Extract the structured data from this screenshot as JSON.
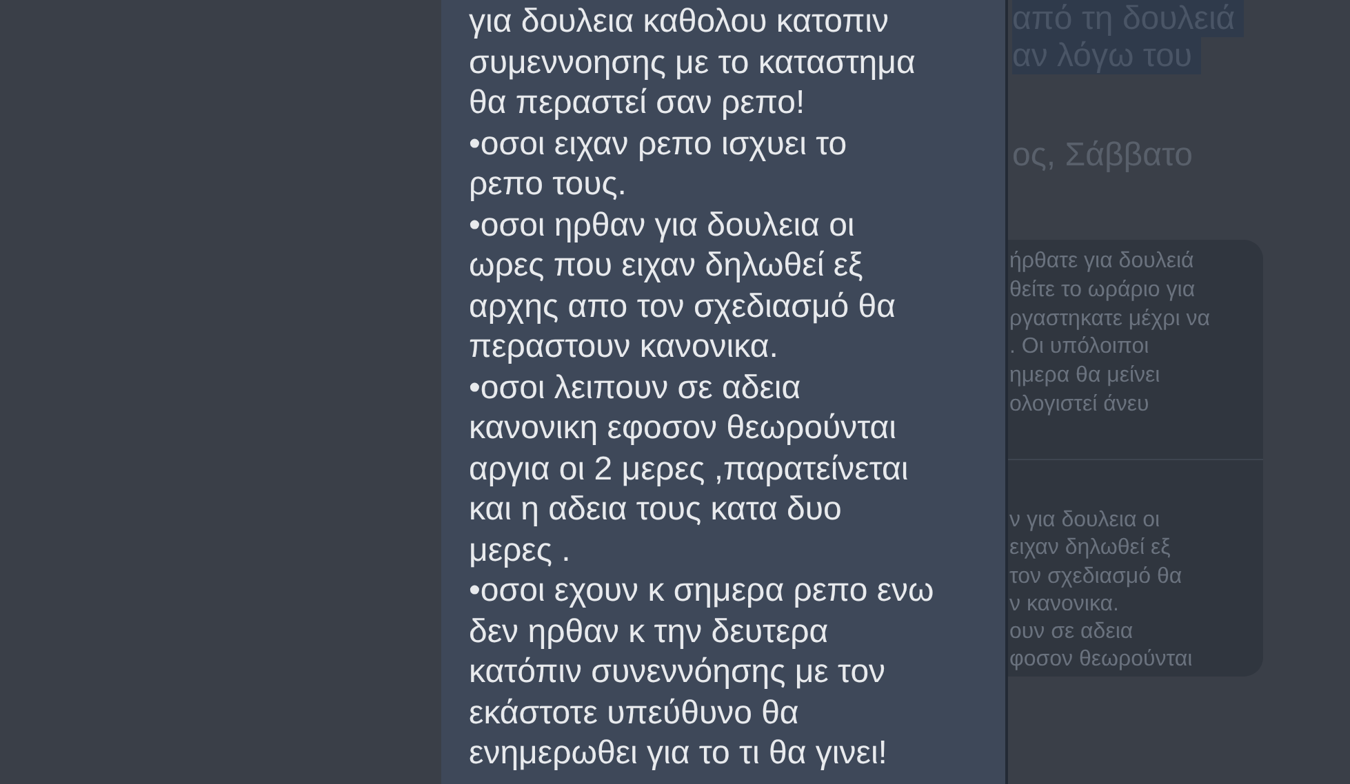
{
  "background": {
    "highlighted_lines": [
      "από τη δουλειά",
      "αν λόγω του"
    ],
    "date_line": "ος, Σάββατο",
    "card": {
      "upper_lines": [
        "ήρθατε για δουλειά",
        "θείτε το ωράριο για",
        "ργαστηκατε μέχρι να",
        ". Οι υπόλοιποι",
        "ημερα θα μείνει",
        "ολογιστεί άνευ"
      ],
      "lower_lines": [
        "ν για δουλεια οι",
        "ειχαν δηλωθεί εξ",
        "τον σχεδιασμό θα",
        "ν κανονικα.",
        "ουν σε αδεια",
        "φοσον θεωρούνται"
      ]
    }
  },
  "popup": {
    "paragraphs": [
      {
        "lines": [
          "για δουλεια καθολου κατοπιν",
          "συμεννοησης με το καταστημα",
          "θα περαστεί σαν ρεπο!"
        ]
      },
      {
        "lines": [
          "•οσοι ειχαν ρεπο ισχυει το",
          "ρεπο τους."
        ]
      },
      {
        "lines": [
          "•οσοι ηρθαν για δουλεια οι",
          "ωρες που ειχαν δηλωθεί εξ",
          "αρχης απο τον σχεδιασμό θα",
          "περαστουν κανονικα."
        ]
      },
      {
        "lines": [
          "•οσοι λειπουν σε αδεια",
          "κανονικη εφοσον θεωρούνται",
          "αργια οι 2 μερες ,παρατείνεται",
          "και η αδεια τους κατα δυο",
          "μερες ."
        ]
      },
      {
        "lines": [
          "•οσοι εχουν κ σημερα ρεπο ενω",
          "δεν ηρθαν κ την δευτερα",
          "κατόπιν συνεννόησης με τον",
          "εκάστοτε υπεύθυνο θα",
          "ενημερωθει για το τι θα γινει!"
        ]
      }
    ]
  }
}
